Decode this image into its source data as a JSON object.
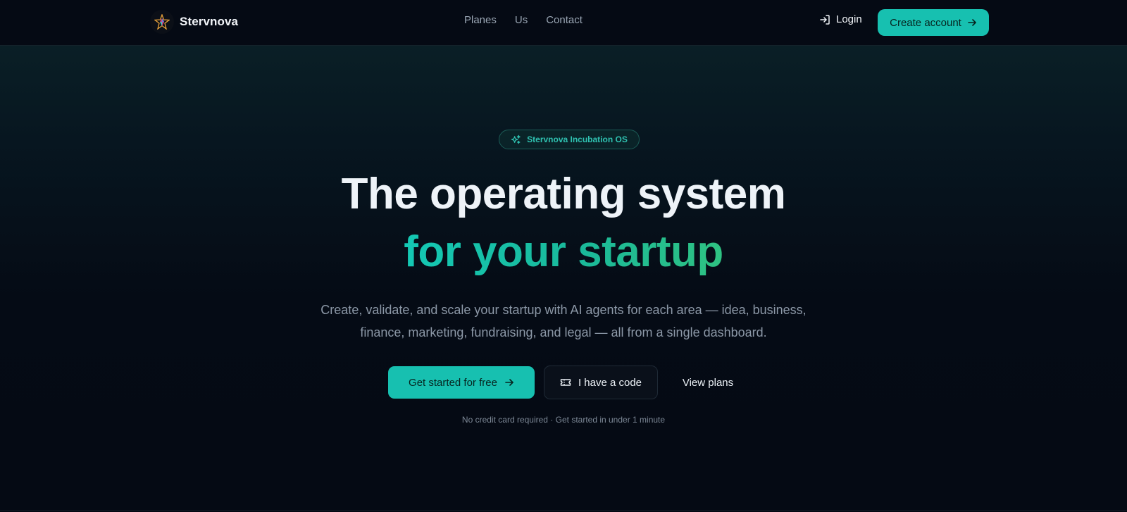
{
  "header": {
    "brand": "Stervnova",
    "nav": [
      "Planes",
      "Us",
      "Contact"
    ],
    "login_label": "Login",
    "create_account_label": "Create account"
  },
  "hero": {
    "badge": "Stervnova Incubation OS",
    "headline": "The operating system",
    "headline_accent": "for your startup",
    "subtitle_lines": [
      "Create, validate, and scale your startup with AI agents for each area — idea, business,",
      "finance, marketing, fundraising, and legal — all from a single dashboard."
    ],
    "cta_primary": "Get started for free",
    "cta_code": "I have a code",
    "cta_plans": "View plans",
    "fineprint": "No credit card required · Get started in under 1 minute"
  },
  "colors": {
    "accent": "#17c0b0",
    "accent_gradient_end": "#2fc282",
    "background": "#050a14"
  },
  "icons": {
    "logo": "star-gem-logo-icon",
    "login": "login-arrow-icon",
    "create_account": "arrow-right-icon",
    "badge": "sparkles-icon",
    "cta_primary": "arrow-right-icon",
    "cta_code": "ticket-icon"
  }
}
